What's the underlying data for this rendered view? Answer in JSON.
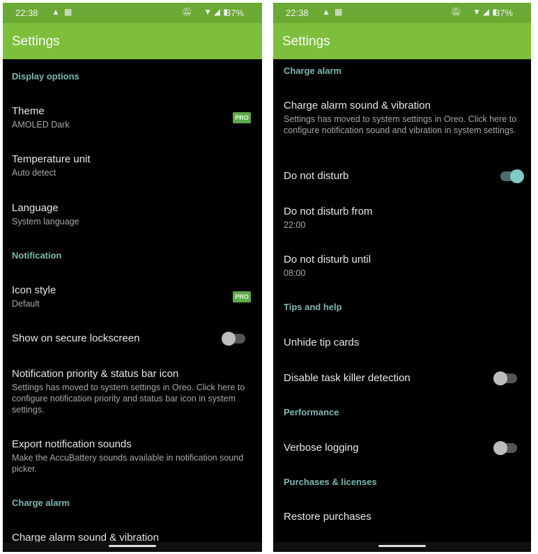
{
  "colors": {
    "status_bar": "#6aaa34",
    "app_bar": "#7dbf3c",
    "category": "#7db8b0",
    "pro_badge": "#5fa84a",
    "toggle_on": "#80cbc4"
  },
  "status": {
    "time": "22:38",
    "battery": "37%",
    "icons": [
      "navigation-icon",
      "screenshot-icon",
      "bell-off-icon",
      "wifi-icon",
      "signal-icon",
      "battery-icon"
    ]
  },
  "left": {
    "title": "Settings",
    "display_options": "Display options",
    "theme": "Theme",
    "theme_value": "AMOLED Dark",
    "pro": "PRO",
    "temp": "Temperature unit",
    "temp_value": "Auto detect",
    "language": "Language",
    "language_value": "System language",
    "notification": "Notification",
    "icon_style": "Icon style",
    "icon_style_value": "Default",
    "lockscreen": "Show on secure lockscreen",
    "lockscreen_on": false,
    "priority": "Notification priority & status bar icon",
    "priority_desc": "Settings has moved to system settings in Oreo. Click here to configure notification priority and status bar icon in system settings.",
    "export": "Export notification sounds",
    "export_desc": "Make the AccuBattery sounds available in notification sound picker.",
    "charge_alarm": "Charge alarm",
    "charge_sound": "Charge alarm sound & vibration"
  },
  "right": {
    "title": "Settings",
    "charge_alarm": "Charge alarm",
    "charge_sound": "Charge alarm sound & vibration",
    "charge_sound_desc": "Settings has moved to system settings in Oreo. Click here to configure notification sound and vibration in system settings.",
    "dnd": "Do not disturb",
    "dnd_on": true,
    "dnd_from": "Do not disturb from",
    "dnd_from_value": "22:00",
    "dnd_until": "Do not disturb until",
    "dnd_until_value": "08:00",
    "tips": "Tips and help",
    "unhide": "Unhide tip cards",
    "task_killer": "Disable task killer detection",
    "task_killer_on": false,
    "performance": "Performance",
    "verbose": "Verbose logging",
    "verbose_on": false,
    "purchases": "Purchases & licenses",
    "restore": "Restore purchases"
  }
}
